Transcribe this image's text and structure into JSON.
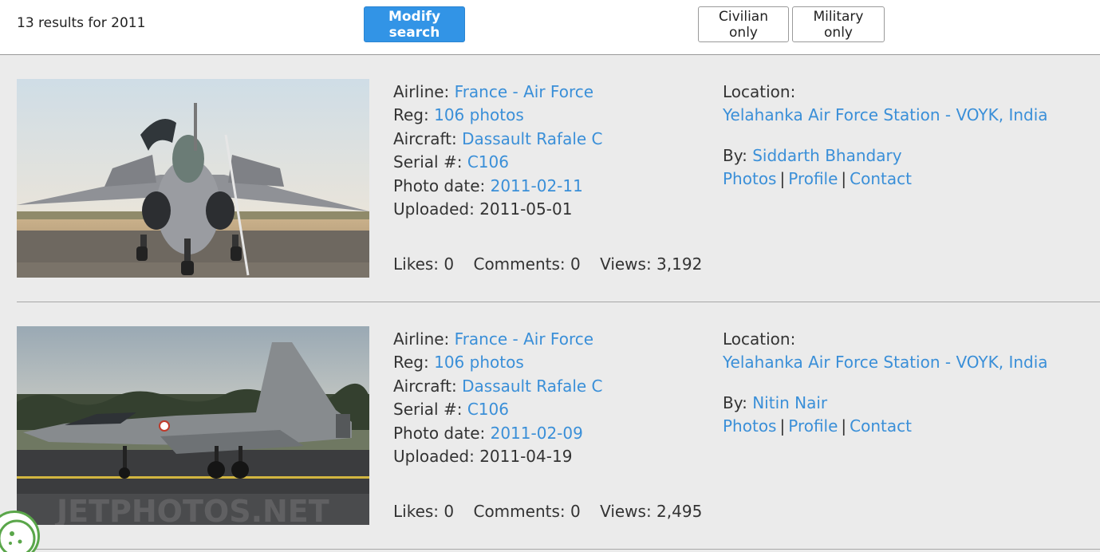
{
  "header": {
    "results_text": "13 results for 2011",
    "modify_label": "Modify search",
    "civilian_label": "Civilian only",
    "military_label": "Military only"
  },
  "labels": {
    "airline": "Airline:",
    "reg": "Reg:",
    "aircraft": "Aircraft:",
    "serial": "Serial #:",
    "photo_date": "Photo date:",
    "uploaded": "Uploaded:",
    "location": "Location:",
    "by": "By:",
    "photos": "Photos",
    "profile": "Profile",
    "contact": "Contact",
    "separator": "|"
  },
  "photos": [
    {
      "airline": "France - Air Force",
      "reg": "106 photos",
      "aircraft": "Dassault Rafale C",
      "serial": "C106",
      "photo_date": "2011-02-11",
      "uploaded": "2011-05-01",
      "likes": "Likes: 0",
      "comments": "Comments: 0",
      "views": "Views: 3,192",
      "location": "Yelahanka Air Force Station - VOYK, India",
      "photographer": "Siddarth Bhandary"
    },
    {
      "airline": "France - Air Force",
      "reg": "106 photos",
      "aircraft": "Dassault Rafale C",
      "serial": "C106",
      "photo_date": "2011-02-09",
      "uploaded": "2011-04-19",
      "likes": "Likes: 0",
      "comments": "Comments: 0",
      "views": "Views: 2,495",
      "location": "Yelahanka Air Force Station - VOYK, India",
      "photographer": "Nitin Nair",
      "watermark": "JETPHOTOS.NET"
    }
  ],
  "colors": {
    "link": "#3a8fd8",
    "button": "#3294e6",
    "background": "#ebebeb"
  },
  "icons": {
    "cookie": "cookie-settings-icon"
  }
}
